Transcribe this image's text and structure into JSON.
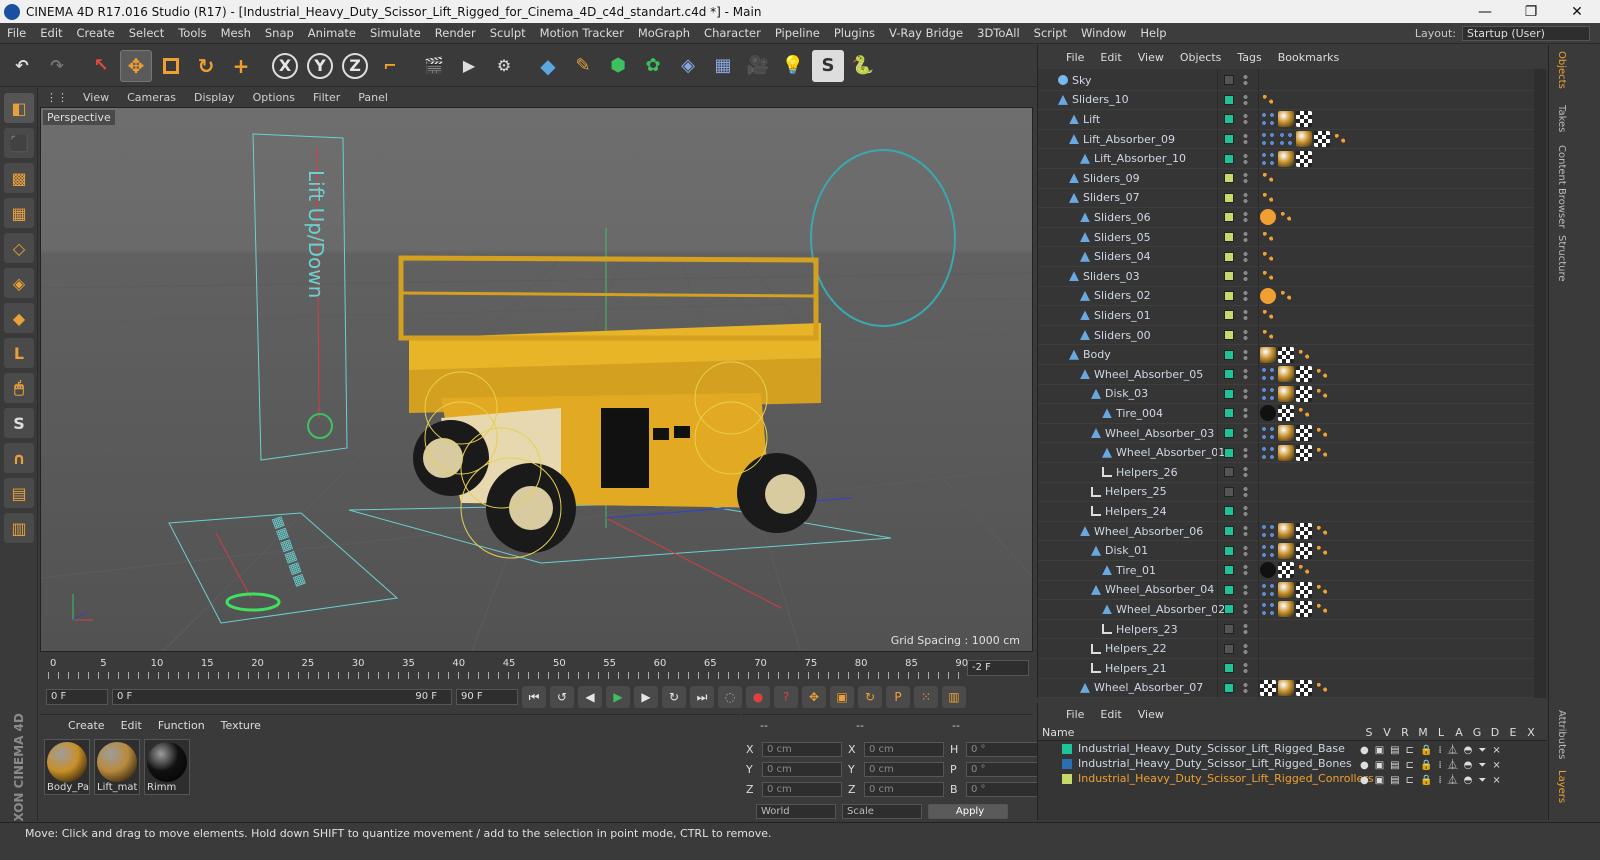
{
  "window": {
    "title": "CINEMA 4D R17.016 Studio (R17) - [Industrial_Heavy_Duty_Scissor_Lift_Rigged_for_Cinema_4D_c4d_standart.c4d *] - Main",
    "min": "—",
    "max": "❐",
    "close": "✕"
  },
  "menu": [
    "File",
    "Edit",
    "Create",
    "Select",
    "Tools",
    "Mesh",
    "Snap",
    "Animate",
    "Simulate",
    "Render",
    "Sculpt",
    "Motion Tracker",
    "MoGraph",
    "Character",
    "Pipeline",
    "Plugins",
    "V-Ray Bridge",
    "3DToAll",
    "Script",
    "Window",
    "Help"
  ],
  "layout": {
    "label": "Layout:",
    "value": "Startup (User)"
  },
  "toolbar": {
    "x": "X",
    "y": "Y",
    "z": "Z"
  },
  "viewport": {
    "menu": [
      "View",
      "Cameras",
      "Display",
      "Options",
      "Filter",
      "Panel"
    ],
    "label": "Perspective",
    "grid_spacing": "Grid Spacing : 1000 cm",
    "lift_text": "Lift Up/Down"
  },
  "timeline": {
    "ticks": [
      "0",
      "5",
      "10",
      "15",
      "20",
      "25",
      "30",
      "35",
      "40",
      "45",
      "50",
      "55",
      "60",
      "65",
      "70",
      "75",
      "80",
      "85",
      "90"
    ],
    "current": "-2 F"
  },
  "transport": {
    "start": "0 F",
    "range_start": "0 F",
    "range_end": "90 F",
    "end": "90 F"
  },
  "materials": {
    "menu": [
      "Create",
      "Edit",
      "Function",
      "Texture"
    ],
    "items": [
      {
        "name": "Body_Pa",
        "color": "#c8902a"
      },
      {
        "name": "Lift_mat",
        "color": "#b88a3a"
      },
      {
        "name": "Rimm",
        "color": "#111111"
      }
    ]
  },
  "coords": {
    "header": [
      "--",
      "--",
      "--"
    ],
    "rows": [
      {
        "a": "X",
        "av": "0 cm",
        "b": "X",
        "bv": "0 cm",
        "c": "H",
        "cv": "0 °"
      },
      {
        "a": "Y",
        "av": "0 cm",
        "b": "Y",
        "bv": "0 cm",
        "c": "P",
        "cv": "0 °"
      },
      {
        "a": "Z",
        "av": "0 cm",
        "b": "Z",
        "bv": "0 cm",
        "c": "B",
        "cv": "0 °"
      }
    ],
    "mode": "World",
    "scale": "Scale",
    "apply": "Apply"
  },
  "status": "Move: Click and drag to move elements. Hold down SHIFT to quantize movement / add to the selection in point mode, CTRL to remove.",
  "maxon": "MAXON CINEMA 4D",
  "objects": {
    "menu": [
      "File",
      "Edit",
      "View",
      "Objects",
      "Tags",
      "Bookmarks"
    ],
    "rows": [
      {
        "name": "Sky",
        "depth": 0,
        "color": "#555555",
        "tags": ""
      },
      {
        "name": "Sliders_10",
        "depth": 0,
        "color": "#1fc39a",
        "tags": "o"
      },
      {
        "name": "Lift",
        "depth": 1,
        "color": "#1fc39a",
        "tags": "xmc"
      },
      {
        "name": "Lift_Absorber_09",
        "depth": 1,
        "color": "#1fc39a",
        "tags": "xxmco"
      },
      {
        "name": "Lift_Absorber_10",
        "depth": 2,
        "color": "#1fc39a",
        "tags": "xmc"
      },
      {
        "name": "Sliders_09",
        "depth": 1,
        "color": "#c7d96a",
        "tags": "o"
      },
      {
        "name": "Sliders_07",
        "depth": 1,
        "color": "#c7d96a",
        "tags": "o"
      },
      {
        "name": "Sliders_06",
        "depth": 2,
        "color": "#c7d96a",
        "tags": "no"
      },
      {
        "name": "Sliders_05",
        "depth": 2,
        "color": "#c7d96a",
        "tags": "o"
      },
      {
        "name": "Sliders_04",
        "depth": 2,
        "color": "#c7d96a",
        "tags": "o"
      },
      {
        "name": "Sliders_03",
        "depth": 1,
        "color": "#c7d96a",
        "tags": "o"
      },
      {
        "name": "Sliders_02",
        "depth": 2,
        "color": "#c7d96a",
        "tags": "no"
      },
      {
        "name": "Sliders_01",
        "depth": 2,
        "color": "#c7d96a",
        "tags": "o"
      },
      {
        "name": "Sliders_00",
        "depth": 2,
        "color": "#c7d96a",
        "tags": "o"
      },
      {
        "name": "Body",
        "depth": 1,
        "color": "#1fc39a",
        "tags": "mco"
      },
      {
        "name": "Wheel_Absorber_05",
        "depth": 2,
        "color": "#1fc39a",
        "tags": "xmco"
      },
      {
        "name": "Disk_03",
        "depth": 3,
        "color": "#1fc39a",
        "tags": "xmco"
      },
      {
        "name": "Tire_004",
        "depth": 4,
        "color": "#1fc39a",
        "tags": "bco"
      },
      {
        "name": "Wheel_Absorber_03",
        "depth": 3,
        "color": "#1fc39a",
        "tags": "xmco"
      },
      {
        "name": "Wheel_Absorber_01",
        "depth": 4,
        "color": "#1fc39a",
        "tags": "xmco"
      },
      {
        "name": "Helpers_26",
        "depth": 4,
        "color": "#555555",
        "tags": ""
      },
      {
        "name": "Helpers_25",
        "depth": 3,
        "color": "#555555",
        "tags": ""
      },
      {
        "name": "Helpers_24",
        "depth": 3,
        "color": "#1fc39a",
        "tags": ""
      },
      {
        "name": "Wheel_Absorber_06",
        "depth": 2,
        "color": "#1fc39a",
        "tags": "xmco"
      },
      {
        "name": "Disk_01",
        "depth": 3,
        "color": "#1fc39a",
        "tags": "xmco"
      },
      {
        "name": "Tire_01",
        "depth": 4,
        "color": "#1fc39a",
        "tags": "bco"
      },
      {
        "name": "Wheel_Absorber_04",
        "depth": 3,
        "color": "#1fc39a",
        "tags": "xmco"
      },
      {
        "name": "Wheel_Absorber_02",
        "depth": 4,
        "color": "#1fc39a",
        "tags": "xmco"
      },
      {
        "name": "Helpers_23",
        "depth": 4,
        "color": "#555555",
        "tags": ""
      },
      {
        "name": "Helpers_22",
        "depth": 3,
        "color": "#555555",
        "tags": ""
      },
      {
        "name": "Helpers_21",
        "depth": 3,
        "color": "#1fc39a",
        "tags": ""
      },
      {
        "name": "Wheel_Absorber_07",
        "depth": 2,
        "color": "#1fc39a",
        "tags": "cmco"
      }
    ]
  },
  "layers": {
    "menu": [
      "File",
      "Edit",
      "View"
    ],
    "header": {
      "name": "Name",
      "cols": [
        "S",
        "V",
        "R",
        "M",
        "L",
        "A",
        "G",
        "D",
        "E",
        "X"
      ]
    },
    "rows": [
      {
        "name": "Industrial_Heavy_Duty_Scissor_Lift_Rigged_Base",
        "color": "#1fc39a",
        "text": "#cfd7e6"
      },
      {
        "name": "Industrial_Heavy_Duty_Scissor_Lift_Rigged_Bones",
        "color": "#2a6fb0",
        "text": "#cfd7e6"
      },
      {
        "name": "Industrial_Heavy_Duty_Scissor_Lift_Rigged_Conrollers",
        "color": "#c7d96a",
        "text": "#f0a030"
      }
    ]
  },
  "right_tabs": [
    "Objects",
    "Takes",
    "Content Browser",
    "Structure",
    "Attributes",
    "Layers"
  ]
}
